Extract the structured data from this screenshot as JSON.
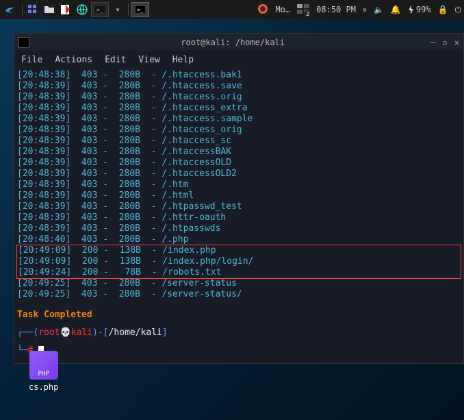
{
  "panel": {
    "clock": "08:50 PM",
    "battery": "99%",
    "badge": "2",
    "app_title": "Mo…"
  },
  "terminal": {
    "title": "root@kali: /home/kali",
    "menu": {
      "file": "File",
      "actions": "Actions",
      "edit": "Edit",
      "view": "View",
      "help": "Help"
    },
    "lines": [
      "[20:48:38]  403 -  280B  - /.htaccess.bak1",
      "[20:48:39]  403 -  280B  - /.htaccess.save",
      "[20:48:39]  403 -  280B  - /.htaccess.orig",
      "[20:48:39]  403 -  280B  - /.htaccess_extra",
      "[20:48:39]  403 -  280B  - /.htaccess.sample",
      "[20:48:39]  403 -  280B  - /.htaccess_orig",
      "[20:48:39]  403 -  280B  - /.htaccess_sc",
      "[20:48:39]  403 -  280B  - /.htaccessBAK",
      "[20:48:39]  403 -  280B  - /.htaccessOLD",
      "[20:48:39]  403 -  280B  - /.htaccessOLD2",
      "[20:48:39]  403 -  280B  - /.htm",
      "[20:48:39]  403 -  280B  - /.html",
      "[20:48:39]  403 -  280B  - /.htpasswd_test",
      "[20:48:39]  403 -  280B  - /.httr-oauth",
      "[20:48:39]  403 -  280B  - /.htpasswds",
      "[20:48:40]  403 -  280B  - /.php"
    ],
    "highlighted": [
      "[20:49:09]  200 -  138B  - /index.php",
      "[20:49:09]  200 -  138B  - /index.php/login/",
      "[20:49:24]  200 -   78B  - /robots.txt"
    ],
    "after": [
      "[20:49:25]  403 -  280B  - /server-status",
      "[20:49:25]  403 -  280B  - /server-status/"
    ],
    "task": "Task Completed",
    "prompt": {
      "user": "root",
      "host": "kali",
      "path": "/home/kali",
      "symbol": "#"
    }
  },
  "desktop": {
    "file_label": "cs.php",
    "file_ext": "PHP"
  }
}
